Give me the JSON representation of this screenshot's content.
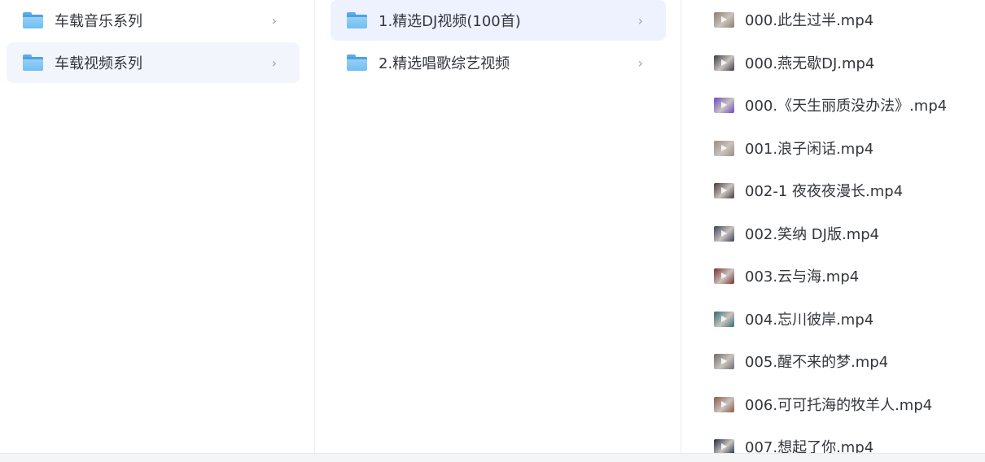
{
  "column1": {
    "items": [
      {
        "label": "车载音乐系列",
        "chevron": "›"
      },
      {
        "label": "车载视频系列",
        "chevron": "›"
      }
    ]
  },
  "column2": {
    "items": [
      {
        "label": "1.精选DJ视频(100首)",
        "chevron": "›"
      },
      {
        "label": "2.精选唱歌综艺视频",
        "chevron": "›"
      }
    ]
  },
  "column3": {
    "files": [
      {
        "label": "000.此生过半.mp4",
        "thumb_color": "#8a7f6e"
      },
      {
        "label": "000.燕无歇DJ.mp4",
        "thumb_color": "#3b3a44"
      },
      {
        "label": "000.《天生丽质没办法》.mp4",
        "thumb_color": "#6b48c8"
      },
      {
        "label": "001.浪子闲话.mp4",
        "thumb_color": "#9a8c86"
      },
      {
        "label": "002-1 夜夜夜漫长.mp4",
        "thumb_color": "#4a3a3e"
      },
      {
        "label": "002.笑纳 DJ版.mp4",
        "thumb_color": "#3c3f5a"
      },
      {
        "label": "003.云与海.mp4",
        "thumb_color": "#7a2f2f"
      },
      {
        "label": "004.忘川彼岸.mp4",
        "thumb_color": "#2f6c76"
      },
      {
        "label": "005.醒不来的梦.mp4",
        "thumb_color": "#6e6c70"
      },
      {
        "label": "006.可可托海的牧羊人.mp4",
        "thumb_color": "#8a5a44"
      },
      {
        "label": "007.想起了你.mp4",
        "thumb_color": "#1f2a44"
      }
    ]
  }
}
